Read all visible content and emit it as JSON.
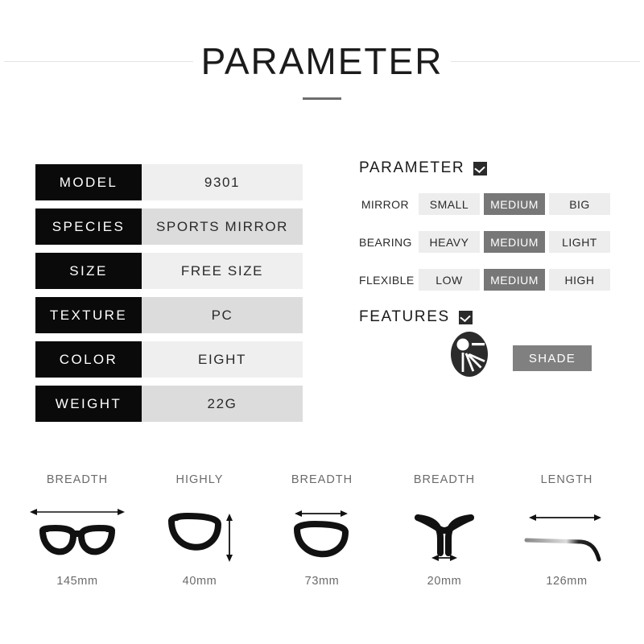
{
  "header": {
    "title": "PARAMETER"
  },
  "spec_table": {
    "rows": [
      {
        "label": "MODEL",
        "value": "9301"
      },
      {
        "label": "SPECIES",
        "value": "SPORTS MIRROR"
      },
      {
        "label": "SIZE",
        "value": "FREE SIZE"
      },
      {
        "label": "TEXTURE",
        "value": "PC"
      },
      {
        "label": "COLOR",
        "value": "EIGHT"
      },
      {
        "label": "WEIGHT",
        "value": "22G"
      }
    ]
  },
  "parameter_panel": {
    "heading": "PARAMETER",
    "rows": [
      {
        "label": "MIRROR",
        "options": [
          "SMALL",
          "MEDIUM",
          "BIG"
        ],
        "selected": "MEDIUM"
      },
      {
        "label": "BEARING",
        "options": [
          "HEAVY",
          "MEDIUM",
          "LIGHT"
        ],
        "selected": "MEDIUM"
      },
      {
        "label": "FLEXIBLE",
        "options": [
          "LOW",
          "MEDIUM",
          "HIGH"
        ],
        "selected": "MEDIUM"
      }
    ]
  },
  "features_panel": {
    "heading": "FEATURES",
    "icon": "sun-shade-icon",
    "button_label": "SHADE"
  },
  "measurements": [
    {
      "title": "BREADTH",
      "value": "145mm",
      "icon": "full-frame-width-icon"
    },
    {
      "title": "HIGHLY",
      "value": "40mm",
      "icon": "lens-height-icon"
    },
    {
      "title": "BREADTH",
      "value": "73mm",
      "icon": "lens-width-icon"
    },
    {
      "title": "BREADTH",
      "value": "20mm",
      "icon": "bridge-width-icon"
    },
    {
      "title": "LENGTH",
      "value": "126mm",
      "icon": "temple-length-icon"
    }
  ],
  "colors": {
    "label_bg": "#0a0a0a",
    "value_bg_light": "#efefef",
    "value_bg_dark": "#dcdcdc",
    "chip_bg": "#ededed",
    "chip_selected_bg": "#777777",
    "shade_button_bg": "#808080",
    "muted_text": "#6b6b6b"
  }
}
